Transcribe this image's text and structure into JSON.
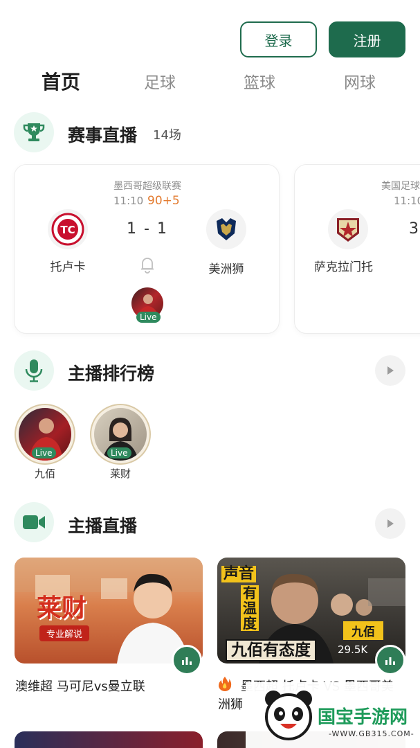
{
  "auth": {
    "login_label": "登录",
    "register_label": "注册"
  },
  "tabs": [
    {
      "label": "首页",
      "active": true
    },
    {
      "label": "足球",
      "active": false
    },
    {
      "label": "篮球",
      "active": false
    },
    {
      "label": "网球",
      "active": false
    }
  ],
  "live_matches": {
    "title": "赛事直播",
    "count": "14场",
    "matches": [
      {
        "league": "墨西哥超级联赛",
        "time": "11:10",
        "minute": "90+5",
        "score": "1 - 1",
        "home": "托卢卡",
        "away": "美洲狮",
        "live_label": "Live"
      },
      {
        "league": "美国足球",
        "time": "11:10",
        "score": "3",
        "home": "萨克拉门托"
      }
    ]
  },
  "anchor_ranking": {
    "title": "主播排行榜",
    "anchors": [
      {
        "name": "九佰",
        "live_label": "Live"
      },
      {
        "name": "莱财",
        "live_label": "Live"
      }
    ]
  },
  "anchor_live": {
    "title": "主播直播",
    "videos": [
      {
        "poster_title": "莱财",
        "poster_tag": "专业解说",
        "title": "澳维超 马可尼vs曼立联"
      },
      {
        "poster_text_1": "声音",
        "poster_text_2": "有温度",
        "poster_name": "九佰",
        "poster_slogan": "九佰有态度",
        "viewers": "29.5K",
        "title": "墨西超 托卢卡 VS 墨西哥美",
        "title_line2": "洲狮"
      }
    ]
  },
  "watermark": {
    "text": "国宝手游网",
    "url": "-WWW.GB315.COM-"
  },
  "colors": {
    "brand": "#1e6b4d",
    "accent_orange": "#e37b2f",
    "live_green": "#2f8a5e"
  }
}
